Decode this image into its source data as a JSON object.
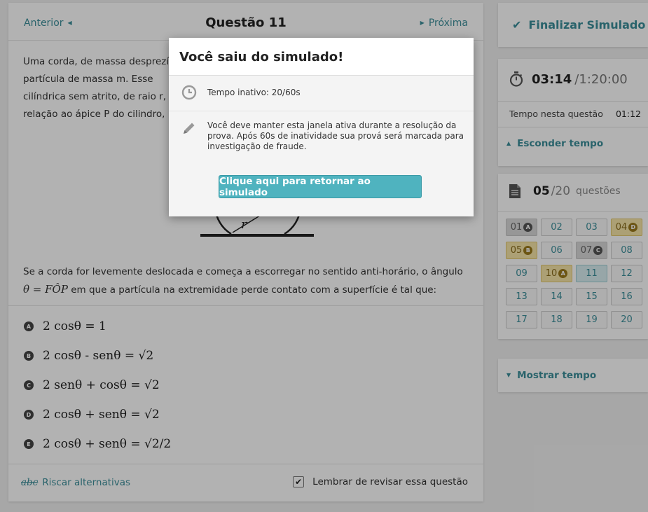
{
  "question": {
    "nav_prev": "Anterior",
    "nav_next": "Próxima",
    "title": "Questão 11",
    "text_lines": [
      "Uma corda, de massa desprezí",
      "partícula de massa m. Esse",
      "cilíndrica sem atrito, de raio r,",
      "relação ao ápice P do cilindro,"
    ],
    "diagram_label": "r",
    "prompt_part1": "Se a corda for levemente deslocada e começa a escorregar no sentido anti-horário, o ângulo",
    "prompt_math": "θ = FÔP",
    "prompt_part2": "em que a partícula na extremidade  perde contato com a superfície é tal que:",
    "options": [
      {
        "letter": "A",
        "text": "2 cosθ = 1"
      },
      {
        "letter": "B",
        "text": "2 cosθ - senθ = √2"
      },
      {
        "letter": "C",
        "text": "2 senθ + cosθ = √2"
      },
      {
        "letter": "D",
        "text": "2 cosθ + senθ = √2"
      },
      {
        "letter": "E",
        "text": "2 cosθ + senθ = √2/2"
      }
    ],
    "riscar_icon_text": "abc",
    "riscar_label": "Riscar alternativas",
    "lembrar_label": "Lembrar de revisar essa questão",
    "lembrar_checked": "✔"
  },
  "sidebar": {
    "finalize_label": "Finalizar Simulado",
    "time_elapsed": "03:14",
    "time_total": "/1:20:00",
    "time_question_label": "Tempo nesta questão",
    "time_question_value": "01:12",
    "hide_time_label": "Esconder tempo",
    "answered_count": "05",
    "total_questions": "/20",
    "questions_word": "questões",
    "show_time_label": "Mostrar tempo",
    "grid": [
      {
        "num": "01",
        "badge": "A",
        "state": "ans-gray"
      },
      {
        "num": "02",
        "badge": "",
        "state": ""
      },
      {
        "num": "03",
        "badge": "",
        "state": ""
      },
      {
        "num": "04",
        "badge": "D",
        "state": "ans-yellow"
      },
      {
        "num": "05",
        "badge": "B",
        "state": "ans-yellow"
      },
      {
        "num": "06",
        "badge": "",
        "state": ""
      },
      {
        "num": "07",
        "badge": "C",
        "state": "ans-gray"
      },
      {
        "num": "08",
        "badge": "",
        "state": ""
      },
      {
        "num": "09",
        "badge": "",
        "state": ""
      },
      {
        "num": "10",
        "badge": "A",
        "state": "ans-yellow"
      },
      {
        "num": "11",
        "badge": "",
        "state": "current"
      },
      {
        "num": "12",
        "badge": "",
        "state": ""
      },
      {
        "num": "13",
        "badge": "",
        "state": ""
      },
      {
        "num": "14",
        "badge": "",
        "state": ""
      },
      {
        "num": "15",
        "badge": "",
        "state": ""
      },
      {
        "num": "16",
        "badge": "",
        "state": ""
      },
      {
        "num": "17",
        "badge": "",
        "state": ""
      },
      {
        "num": "18",
        "badge": "",
        "state": ""
      },
      {
        "num": "19",
        "badge": "",
        "state": ""
      },
      {
        "num": "20",
        "badge": "",
        "state": ""
      }
    ]
  },
  "modal": {
    "title": "Você saiu do simulado!",
    "inactive_text": "Tempo inativo: 20/60s",
    "warning_text": "Você deve manter esta janela ativa durante a resolução da prova. Após 60s de inatividade sua prová será marcada para investigação de fraude.",
    "return_button": "Clique aqui para retornar ao simulado"
  },
  "colors": {
    "accent": "#3b8e9a",
    "button": "#4fb3bf",
    "answered_gray": "#d9d9d9",
    "answered_yellow": "#f6e5a8",
    "current": "#d8eef1"
  },
  "icons": {
    "prev": "caret-left-icon",
    "next": "caret-right-icon",
    "finalize": "check-icon",
    "timer": "stopwatch-icon",
    "questions": "document-icon",
    "inactive": "clock-icon",
    "warning": "pencil-icon"
  }
}
